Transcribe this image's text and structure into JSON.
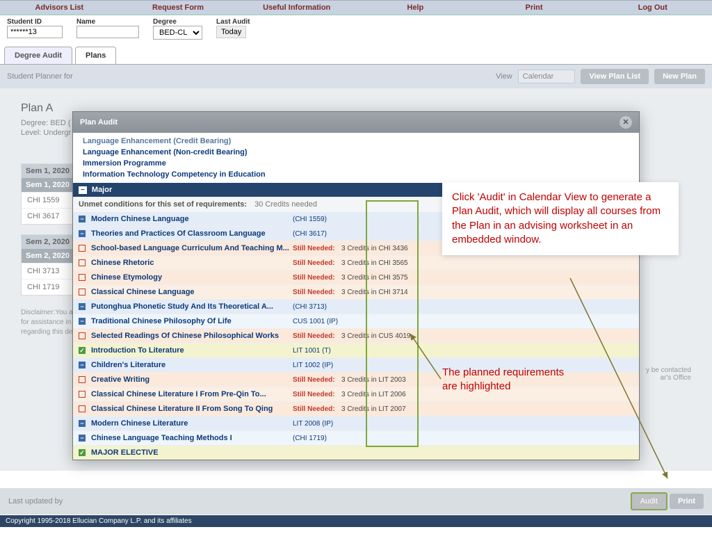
{
  "topnav": [
    "Advisors List",
    "Request Form",
    "Useful Information",
    "Help",
    "Print",
    "Log Out"
  ],
  "search": {
    "sid_label": "Student ID",
    "sid_value": "******13",
    "name_label": "Name",
    "name_value": "",
    "degree_label": "Degree",
    "degree_value": "BED-CL",
    "last_audit_label": "Last Audit",
    "last_audit_value": "Today"
  },
  "tabs": {
    "audit": "Degree Audit",
    "plans": "Plans"
  },
  "planner": {
    "prefix": "Student Planner for",
    "view_label": "View",
    "view_value": "Calendar",
    "btn_list": "View Plan List",
    "btn_new": "New Plan"
  },
  "plan_bg": {
    "title": "Plan A",
    "degree": "Degree: BED (",
    "level": "Level: Undergr"
  },
  "sem1": {
    "head": "Sem 1, 2020",
    "sel": "Sem 1, 2020",
    "r1": "CHI 1559",
    "r2": "CHI 3617"
  },
  "sem2": {
    "head": "Sem 2, 2020",
    "sel": "Sem 2, 2020",
    "r1": "CHI 3713",
    "r2": "CHI 1719"
  },
  "disclaimer1": "Disclaimer:You ar",
  "disclaimer2": "for assistance in i",
  "disclaimer3": "regarding this deg",
  "disclaimer_tail1": "y be contacted",
  "disclaimer_tail2": "ar's Office",
  "footer": {
    "last": "Last updated by",
    "audit": "Audit",
    "print": "Print"
  },
  "copyright": "Copyright 1995-2018 Ellucian Company L.P. and its affiliates",
  "modal": {
    "title": "Plan Audit",
    "links": [
      "Language Enhancement (Credit Bearing)",
      "Language Enhancement (Non-credit Bearing)",
      "Immersion Programme",
      "Information Technology Competency in Education"
    ],
    "major": "Major",
    "unmet": "Unmet conditions for this set of requirements:",
    "credits": "30 Credits needed",
    "rows": [
      {
        "ico": "minus",
        "name": "Modern Chinese Language",
        "code": "(CHI 1559)",
        "cls": "blue"
      },
      {
        "ico": "minus",
        "name": "Theories and Practices Of Classroom Language",
        "code": "(CHI 3617)",
        "cls": "blue"
      },
      {
        "ico": "empty",
        "name": "School-based Language Curriculum And Teaching M...",
        "still": "Still Needed:",
        "det": "3 Credits in CHI 3436",
        "cls": "peach"
      },
      {
        "ico": "empty",
        "name": "Chinese Rhetoric",
        "still": "Still Needed:",
        "det": "3 Credits in CHI 3565",
        "cls": "lpeach"
      },
      {
        "ico": "empty",
        "name": "Chinese Etymology",
        "still": "Still Needed:",
        "det": "3 Credits in CHI 3575",
        "cls": "peach"
      },
      {
        "ico": "empty",
        "name": "Classical Chinese Language",
        "still": "Still Needed:",
        "det": "3 Credits in CHI 3714",
        "cls": "lpeach"
      },
      {
        "ico": "minus",
        "name": "Putonghua Phonetic Study And Its Theoretical A...",
        "code": "(CHI 3713)",
        "cls": "blue"
      },
      {
        "ico": "minus",
        "name": "Traditional Chinese Philosophy Of Life",
        "code": "CUS 1001 (IP)",
        "cls": "lblue"
      },
      {
        "ico": "empty",
        "name": "Selected Readings Of Chinese Philosophical Works",
        "still": "Still Needed:",
        "det": "3 Credits in CUS 4019",
        "cls": "peach"
      },
      {
        "ico": "check",
        "name": "Introduction To Literature",
        "code": "LIT 1001 (T)",
        "cls": "yell"
      },
      {
        "ico": "minus",
        "name": "Children's Literature",
        "code": "LIT 1002 (IP)",
        "cls": "blue"
      },
      {
        "ico": "empty",
        "name": "Creative Writing",
        "still": "Still Needed:",
        "det": "3 Credits in LIT 2003",
        "cls": "peach"
      },
      {
        "ico": "empty",
        "name": "Classical Chinese Literature I From Pre-Qin To...",
        "still": "Still Needed:",
        "det": "3 Credits in LIT 2006",
        "cls": "lpeach"
      },
      {
        "ico": "empty",
        "name": "Classical Chinese Literature II From Song To Qing",
        "still": "Still Needed:",
        "det": "3 Credits in LIT 2007",
        "cls": "peach"
      },
      {
        "ico": "minus",
        "name": "Modern Chinese Literature",
        "code": "LIT 2008 (IP)",
        "cls": "blue"
      },
      {
        "ico": "minus",
        "name": "Chinese Language Teaching Methods I",
        "code": "(CHI 1719)",
        "cls": "lblue"
      },
      {
        "ico": "check",
        "name": "MAJOR ELECTIVE",
        "code": "",
        "cls": "yell"
      }
    ]
  },
  "anno1": "Click 'Audit' in Calendar View to generate a Plan Audit, which will display all courses from the Plan in an advising worksheet in an embedded window.",
  "anno2": "The planned requirements are highlighted"
}
